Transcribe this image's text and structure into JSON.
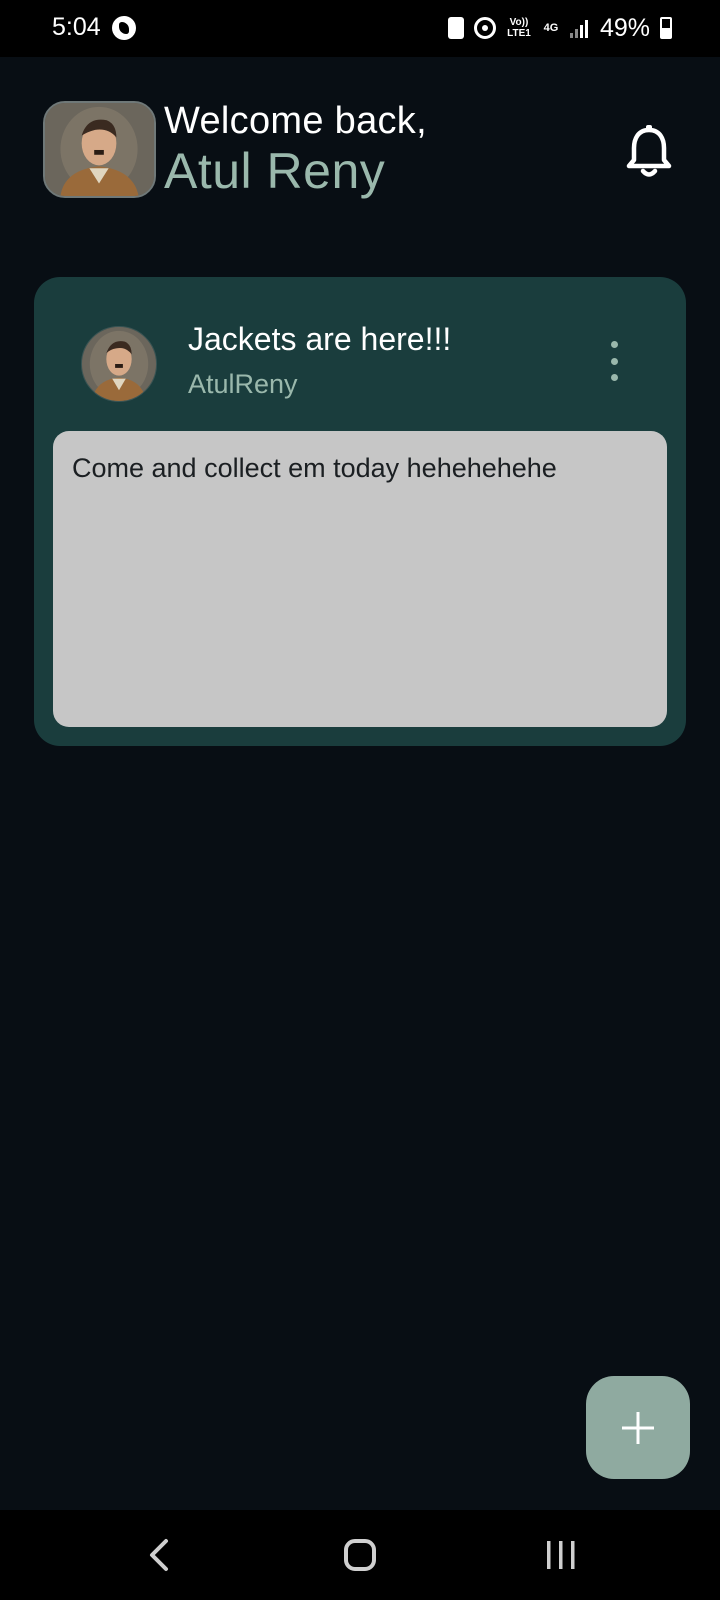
{
  "status_bar": {
    "time": "5:04",
    "volte_label": "Vo))",
    "lte_label": "LTE1",
    "network_label": "4G",
    "battery_percent": "49%"
  },
  "header": {
    "greeting": "Welcome back,",
    "user_name": "Atul Reny",
    "bell_icon": "bell-icon"
  },
  "posts": [
    {
      "title": "Jackets are here!!!",
      "author": "AtulReny",
      "body": "Come and collect em today hehehehehe",
      "menu_icon": "more-vertical-icon"
    }
  ],
  "fab": {
    "icon": "plus-icon"
  },
  "nav": {
    "back_icon": "back-icon",
    "home_icon": "home-icon",
    "recents_icon": "recents-icon"
  },
  "colors": {
    "background": "#080e14",
    "card": "#1a3d3d",
    "accent": "#9ab8ac",
    "post_body": "#c6c6c6",
    "fab": "#8faaa0"
  }
}
